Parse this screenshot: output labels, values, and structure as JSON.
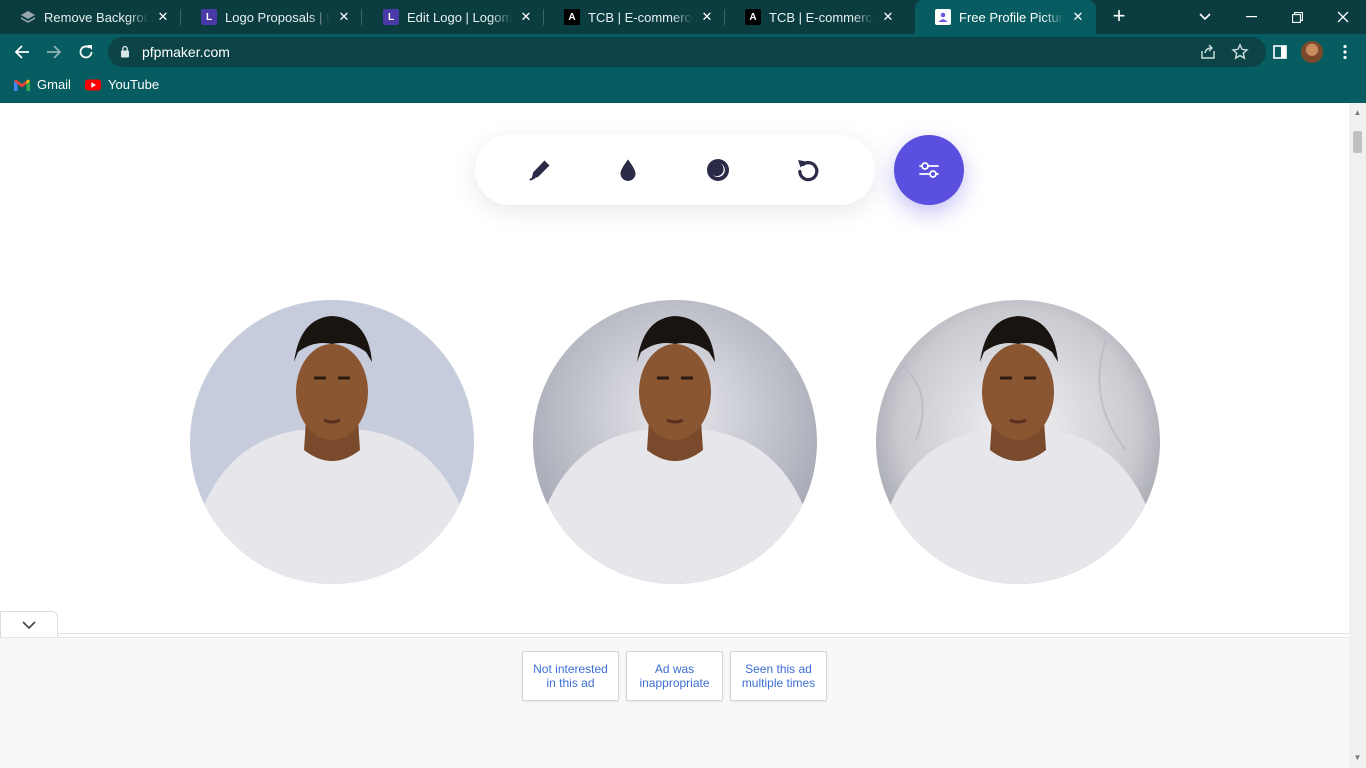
{
  "browser": {
    "tabs": [
      {
        "title": "Remove Background f",
        "favicon": "layers-icon",
        "active": false
      },
      {
        "title": "Logo Proposals | Logo",
        "favicon": "L",
        "active": false
      },
      {
        "title": "Edit Logo | Logomaste",
        "favicon": "L",
        "active": false
      },
      {
        "title": "TCB | E-commerce",
        "favicon": "A",
        "active": false
      },
      {
        "title": "TCB | E-commerce",
        "favicon": "A",
        "active": false
      },
      {
        "title": "Free Profile Picture Ma",
        "favicon": "pfp-icon",
        "active": true
      }
    ],
    "url": "pfpmaker.com",
    "bookmarks": [
      {
        "label": "Gmail",
        "icon": "gmail-icon"
      },
      {
        "label": "YouTube",
        "icon": "youtube-icon"
      }
    ],
    "theme_color": "#075c61"
  },
  "editor": {
    "tools": [
      {
        "name": "pen-icon"
      },
      {
        "name": "drop-icon"
      },
      {
        "name": "moon-icon"
      },
      {
        "name": "rotate-icon"
      }
    ],
    "settings_button": {
      "icon": "sliders-icon",
      "color": "#5b4fe0"
    },
    "previews": [
      {
        "background": "flat light blue-gray"
      },
      {
        "background": "gray gradient"
      },
      {
        "background": "textured silver"
      }
    ]
  },
  "ad": {
    "feedback_options": [
      "Not interested\nin this ad",
      "Ad was\ninappropriate",
      "Seen this ad\nmultiple times"
    ]
  }
}
